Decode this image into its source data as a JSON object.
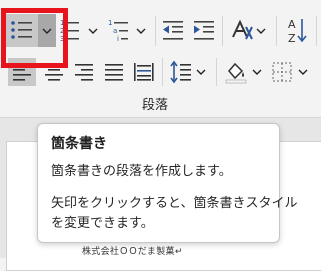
{
  "ribbon": {
    "group_label": "段落",
    "buttons": {
      "bullets": "bullets-icon",
      "numbering": "numbering-icon",
      "multilevel": "multilevel-list-icon",
      "decrease_indent": "decrease-indent-icon",
      "increase_indent": "increase-indent-icon",
      "text_direction": "text-direction-icon",
      "sort": "sort-icon",
      "align_left": "align-left-icon",
      "center": "align-center-icon",
      "align_right": "align-right-icon",
      "justify": "justify-icon",
      "distributed": "distributed-icon",
      "line_spacing": "line-spacing-icon",
      "shading": "shading-icon",
      "borders": "borders-icon"
    },
    "sort_glyph_top": "A",
    "sort_glyph_bottom": "Z"
  },
  "tooltip": {
    "title": "箇条書き",
    "line1": "箇条書きの段落を作成します。",
    "line2": "矢印をクリックすると、箇条書きスタイル",
    "line3": "を変更できます。"
  },
  "document": {
    "text": "株式会社ＯＯだま製菓↵"
  },
  "colors": {
    "accent_blue": "#2b579a",
    "highlight_red": "#e8141b",
    "selected_bg": "#c8c8c8"
  }
}
